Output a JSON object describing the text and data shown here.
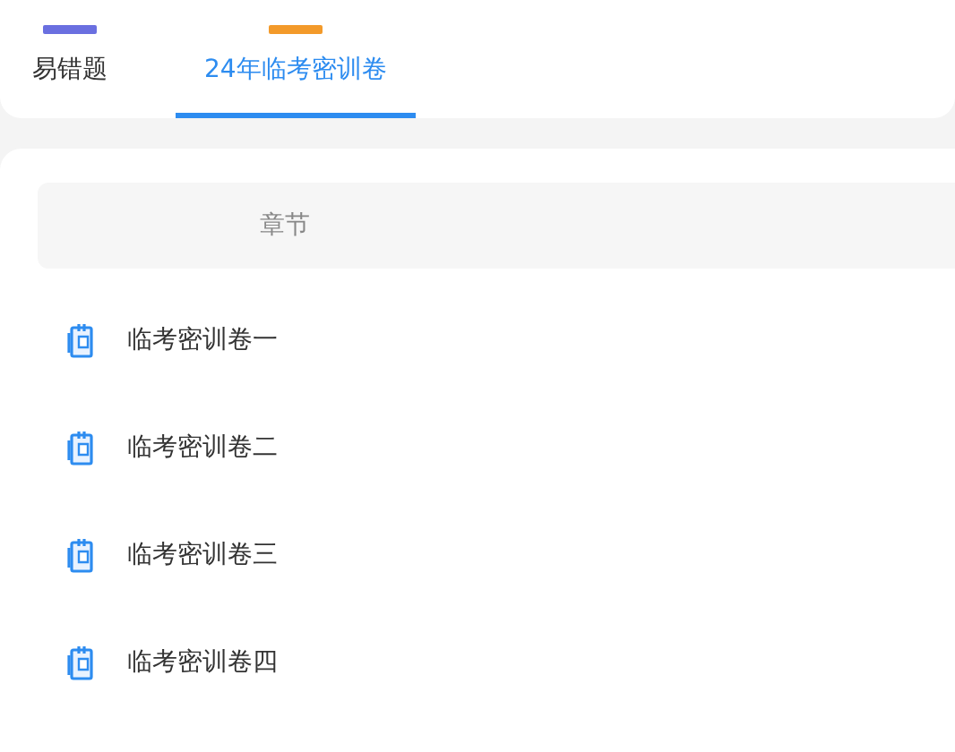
{
  "tabs": [
    {
      "label": "易错题",
      "selected": false,
      "color": "#6a6fe0"
    },
    {
      "label": "24年临考密训卷",
      "selected": true,
      "color": "#f39a2a"
    }
  ],
  "table": {
    "columns": [
      "章节"
    ],
    "rows": [
      {
        "title": "临考密训卷一"
      },
      {
        "title": "临考密训卷二"
      },
      {
        "title": "临考密训卷三"
      },
      {
        "title": "临考密训卷四"
      }
    ]
  }
}
